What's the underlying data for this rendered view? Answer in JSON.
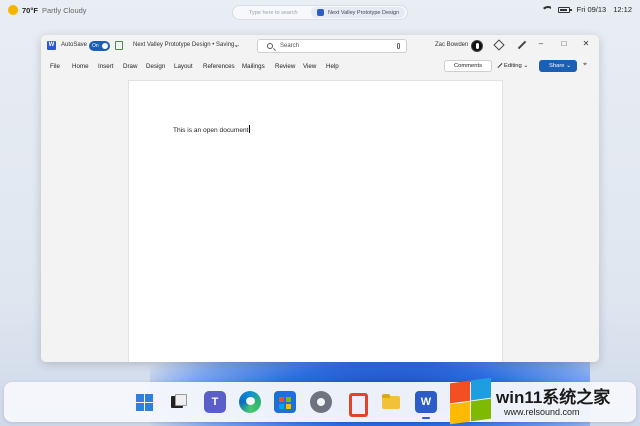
{
  "status_bar": {
    "weather_temp": "70°F",
    "weather_condition": "Partly Cloudy",
    "search_placeholder": "Type here to search",
    "active_app": "Next Valley Prototype Design",
    "date": "Fri 09/13",
    "time": "12:12"
  },
  "word": {
    "autosave_label": "AutoSave",
    "autosave_state": "On",
    "doc_title": "Next Valley Prototype Design • Saving...",
    "search_placeholder": "Search",
    "user_name": "Zac Bowden",
    "menu": [
      "File",
      "Home",
      "Insert",
      "Draw",
      "Design",
      "Layout",
      "References",
      "Mailings",
      "Review",
      "View",
      "Help"
    ],
    "comments_label": "Comments",
    "editing_label": "Editing",
    "share_label": "Share",
    "document_text": "This is an open document"
  },
  "taskbar": {
    "apps": [
      "start",
      "task-view",
      "teams",
      "edge",
      "store",
      "settings",
      "office",
      "file-explorer",
      "word"
    ]
  },
  "watermark": {
    "title": "win11系统之家",
    "url": "www.relsound.com"
  },
  "colors": {
    "word_blue": "#2b5cc7",
    "share_blue": "#1a5fb4"
  }
}
